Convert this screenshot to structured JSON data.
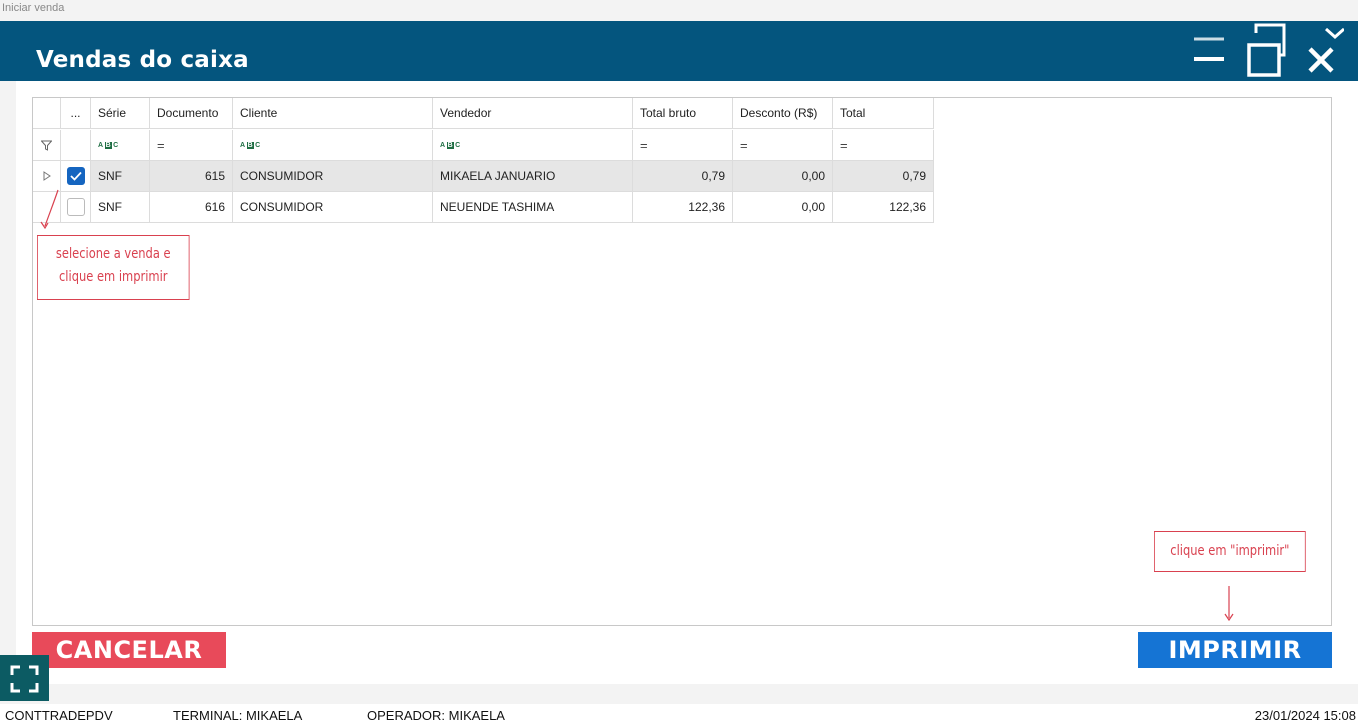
{
  "window": {
    "outer_title": "Iniciar venda",
    "title": "Vendas do caixa"
  },
  "grid": {
    "columns": [
      "...",
      "Série",
      "Documento",
      "Cliente",
      "Vendedor",
      "Total bruto",
      "Desconto (R$)",
      "Total"
    ],
    "filter_row": {
      "serie": "abc-filter-icon",
      "documento": "=",
      "cliente": "abc-filter-icon",
      "vendedor": "abc-filter-icon",
      "total_bruto": "=",
      "desconto": "=",
      "total": "="
    },
    "rows": [
      {
        "checked": true,
        "serie": "SNF",
        "documento": "615",
        "cliente": "CONSUMIDOR",
        "vendedor": "MIKAELA JANUARIO",
        "total_bruto": "0,79",
        "desconto": "0,00",
        "total": "0,79"
      },
      {
        "checked": false,
        "serie": "SNF",
        "documento": "616",
        "cliente": "CONSUMIDOR",
        "vendedor": "NEUENDE TASHIMA",
        "total_bruto": "122,36",
        "desconto": "0,00",
        "total": "122,36"
      }
    ]
  },
  "annotations": {
    "select_line1": "selecione a venda e",
    "select_line2": "clique em imprimir",
    "print_hint": "clique em \"imprimir\""
  },
  "buttons": {
    "cancel": "CANCELAR",
    "print": "IMPRIMIR"
  },
  "statusbar": {
    "app": "CONTTRADEPDV",
    "terminal": "TERMINAL: MIKAELA",
    "operator": "OPERADOR: MIKAELA",
    "datetime": "23/01/2024 15:08"
  },
  "colors": {
    "titlebar": "#04557e",
    "cancel": "#e84a5a",
    "print": "#1574d4",
    "annotation": "#d9414f",
    "checkbox_checked": "#1565c0"
  }
}
